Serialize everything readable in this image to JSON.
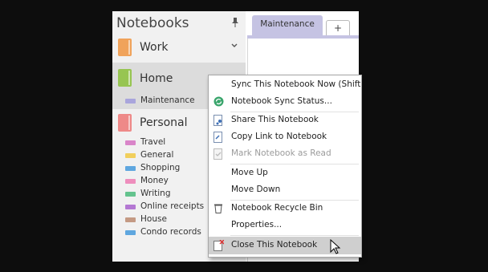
{
  "notebooks_pane": {
    "title": "Notebooks",
    "pin_icon": "pin-icon",
    "notebooks": [
      {
        "name": "Work",
        "color": "#f0a35b",
        "expanded": false
      },
      {
        "name": "Home",
        "color": "#97c552",
        "selected": true,
        "sections": [
          {
            "name": "Maintenance",
            "color": "#a9a5dc"
          }
        ]
      },
      {
        "name": "Personal",
        "color": "#ee8988",
        "sections": [
          {
            "name": "Travel",
            "color": "#d985c9"
          },
          {
            "name": "General",
            "color": "#f1cf5d"
          },
          {
            "name": "Shopping",
            "color": "#5fa7df"
          },
          {
            "name": "Money",
            "color": "#ee8ebd"
          },
          {
            "name": "Writing",
            "color": "#64c38e"
          },
          {
            "name": "Online receipts",
            "color": "#b478d3"
          },
          {
            "name": "House",
            "color": "#c49a84"
          },
          {
            "name": "Condo records",
            "color": "#5fa7df"
          }
        ]
      }
    ]
  },
  "tabs": {
    "active": "Maintenance",
    "active_color": "#c5c3e3",
    "add_label": "+"
  },
  "context_menu": {
    "items": [
      {
        "label": "Sync This Notebook Now  (Shift+",
        "icon": "none"
      },
      {
        "label": "Notebook Sync Status...",
        "icon": "sync-status-icon"
      },
      {
        "label": "Share This Notebook",
        "icon": "share-icon"
      },
      {
        "label": "Copy Link to Notebook",
        "icon": "copy-link-icon"
      },
      {
        "label": "Mark Notebook as Read",
        "icon": "mark-read-icon",
        "disabled": true
      },
      {
        "label": "Move Up",
        "icon": "none"
      },
      {
        "label": "Move Down",
        "icon": "none"
      },
      {
        "label": "Notebook Recycle Bin",
        "icon": "recycle-bin-icon"
      },
      {
        "label": "Properties...",
        "icon": "none"
      },
      {
        "label": "Close This Notebook",
        "icon": "close-notebook-icon",
        "highlighted": true
      }
    ]
  }
}
